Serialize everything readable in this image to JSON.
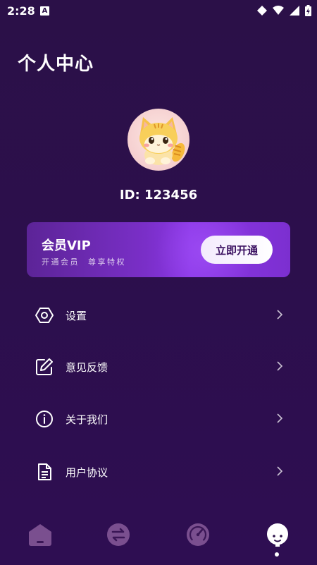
{
  "status_bar": {
    "time": "2:28",
    "notification_badge": "A"
  },
  "header": {
    "title": "个人中心"
  },
  "profile": {
    "id_text": "ID: 123456"
  },
  "vip": {
    "title": "会员VIP",
    "subtitle": "开通会员  尊享特权",
    "button_label": "立即开通"
  },
  "menu": {
    "items": [
      {
        "label": "设置",
        "icon": "settings-hexagon-icon"
      },
      {
        "label": "意见反馈",
        "icon": "feedback-edit-icon"
      },
      {
        "label": "关于我们",
        "icon": "info-icon"
      },
      {
        "label": "用户协议",
        "icon": "document-icon"
      }
    ]
  },
  "bottom_nav": {
    "items": [
      {
        "icon": "home-icon",
        "active": false
      },
      {
        "icon": "convert-icon",
        "active": false
      },
      {
        "icon": "speed-gauge-icon",
        "active": false
      },
      {
        "icon": "profile-face-icon",
        "active": true
      }
    ]
  },
  "colors": {
    "background": "#2b1048",
    "vip_gradient_start": "#5c2497",
    "vip_gradient_end": "#8b37e6",
    "nav_inactive": "#7a4f8f",
    "accent_white": "#ffffff"
  }
}
